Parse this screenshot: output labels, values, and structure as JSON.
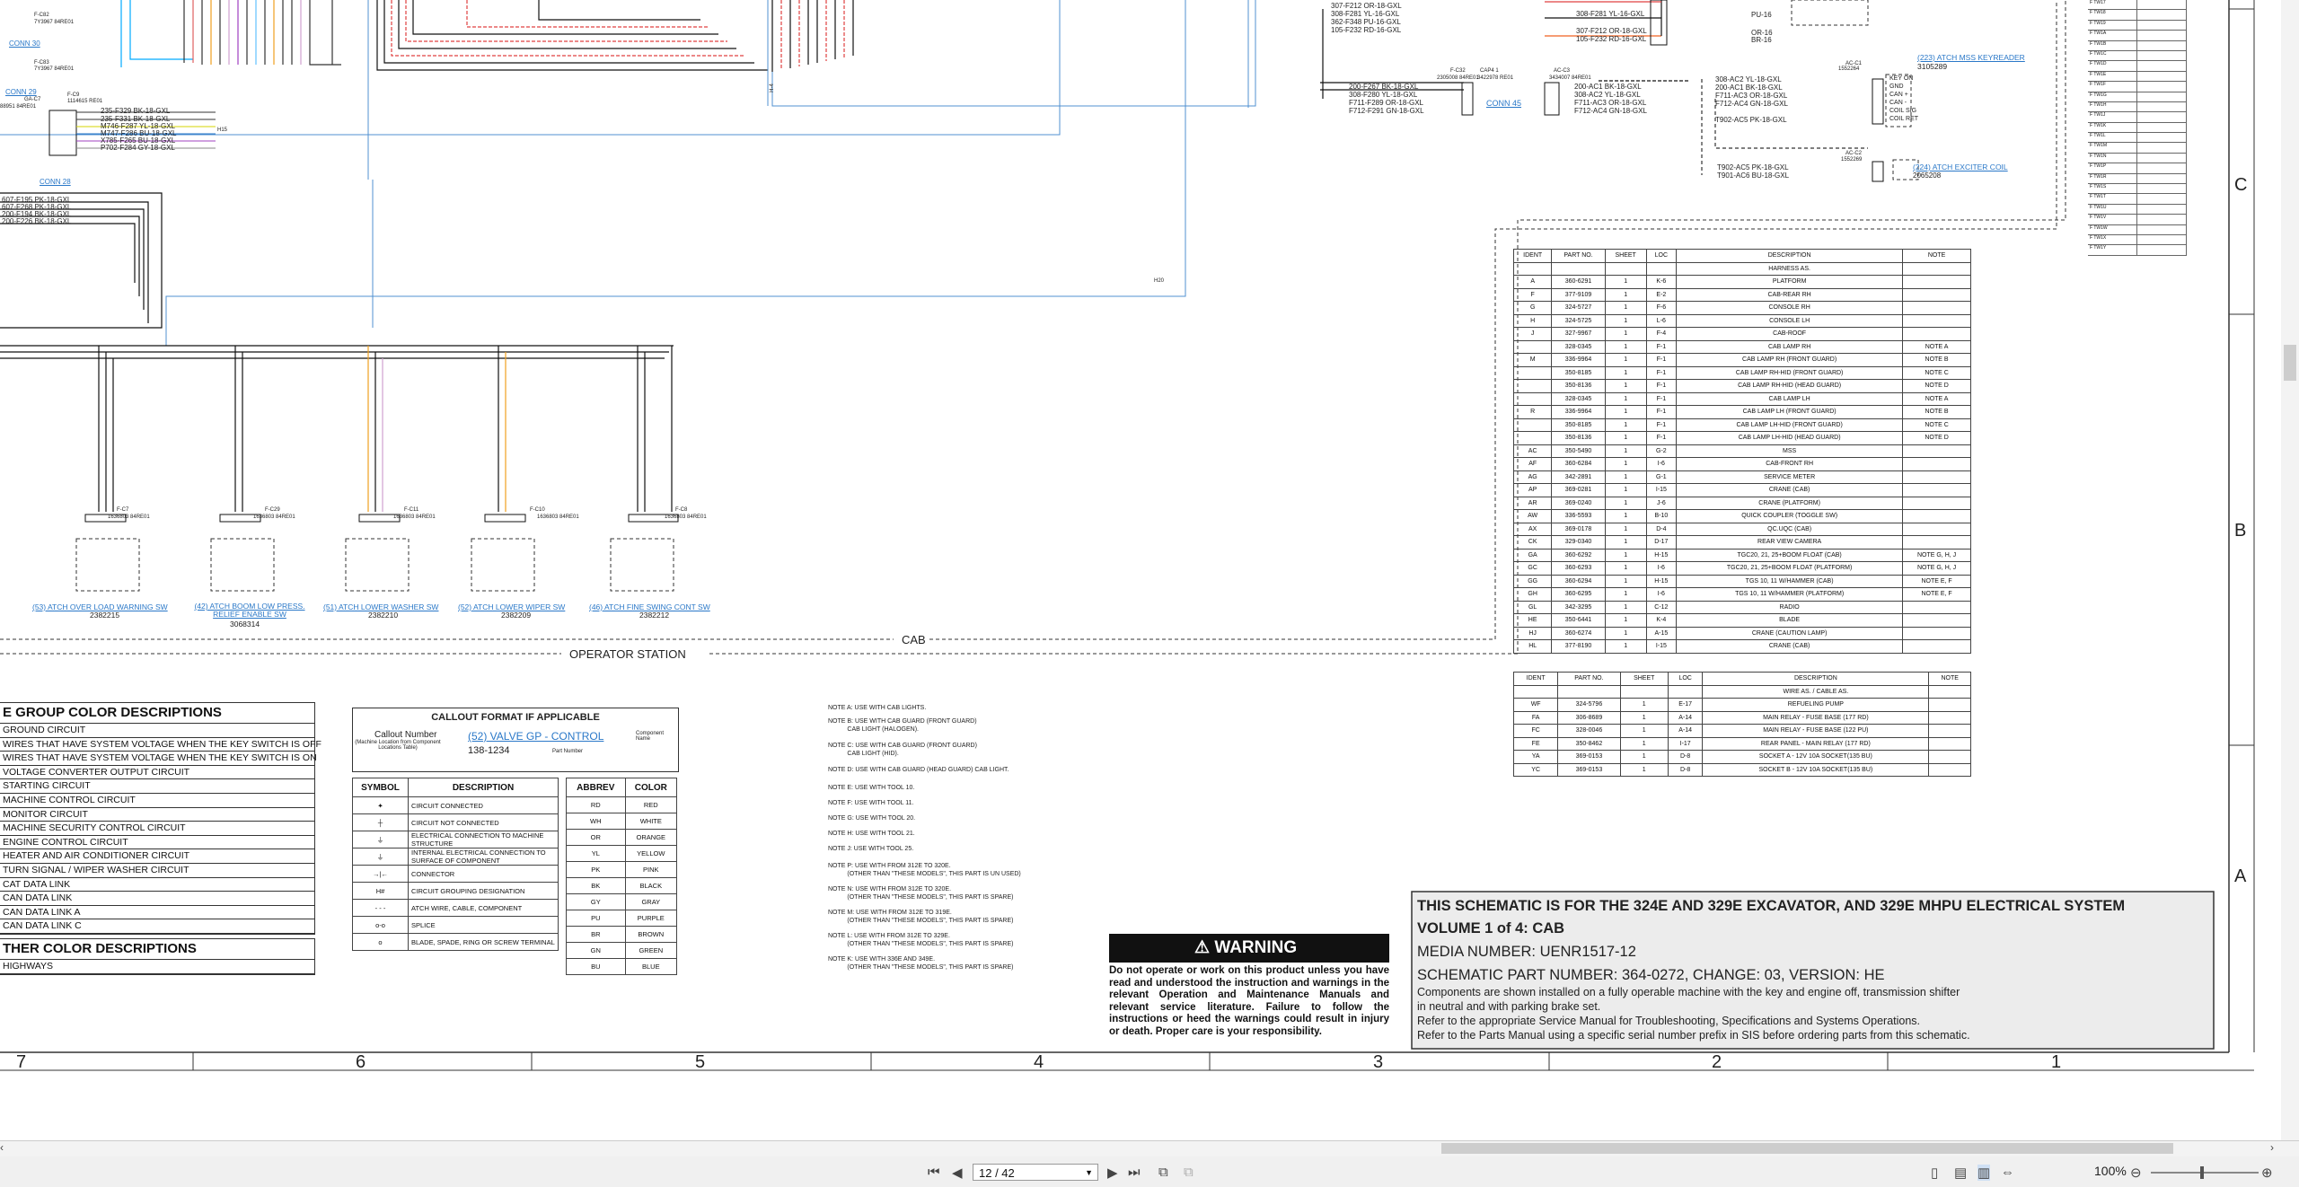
{
  "doc": {
    "cab_label": "CAB",
    "operator_station_label": "OPERATOR STATION",
    "top_right_connectors": {
      "left_wires": [
        "307-F212 OR-18-GXL",
        "308-F281 YL-16-GXL",
        "362-F348 PU-16-GXL",
        "105-F232 RD-16-GXL"
      ],
      "mid_wires": [
        "307-F212 OR-18-GXL",
        "105-F232 RD-16-GXL"
      ],
      "pu_label": "PU-16",
      "or_label": "OR-16",
      "br_label": "BR-16",
      "conn45_wires": [
        "200-F267 BK-18-GXL",
        "308-F280 YL-18-GXL",
        "F711-F289 OR-18-GXL",
        "F712-F291 GN-18-GXL"
      ],
      "c32_label": "F-C32",
      "c32_part": "2305008 84RE01",
      "cap_label": "CAP4 1",
      "cap_part": "3422978 RE01",
      "ac3_label": "AC-C3",
      "ac3_part": "3434007 84RE01",
      "conn45": "CONN 45",
      "ac3_wires": [
        "200-AC1 BK-18-GXL",
        "308-AC2 YL-18-GXL",
        "F711-AC3 OR-18-GXL",
        "F712-AC4 GN-18-GXL"
      ],
      "ac1_wires": [
        "308-AC2 YL-18-GXL",
        "200-AC1 BK-18-GXL",
        "F711-AC3 OR-18-GXL",
        "F712-AC4 GN-18-GXL",
        "T902-AC5 PK-18-GXL"
      ],
      "ac1_label": "AC-C1",
      "ac1_part": "1552264",
      "keyreader_link": "(223) ATCH MSS KEYREADER",
      "keyreader_part": "3105289",
      "ac1_pins": [
        "KEY ON",
        "GND",
        "CAN +",
        "CAN -",
        "COIL SIG",
        "COIL RET"
      ],
      "ac2_label": "AC-C2",
      "ac2_part": "1552269",
      "ac2_wires": [
        "T902-AC5 PK-18-GXL",
        "T901-AC6 BU-18-GXL"
      ],
      "exciter_link": "(224) ATCH EXCITER COIL",
      "exciter_part": "2065208"
    },
    "top_left": {
      "conn30": "CONN 30",
      "conn29": "CONN 29",
      "conn28": "CONN 28",
      "c82": "F-C82",
      "c82_part": "7Y3967 84RE01",
      "c83": "F-C83",
      "c83_part": "7Y3967 84RE01",
      "c7": "GA-C7",
      "c7_part": "88951 84RE01",
      "c9": "F-C9",
      "c9_part": "1114615 RE01",
      "c9_wires": [
        "235-F329 BK-18-GXL",
        "235-F331 BK-18-GXL",
        "M746-F287 YL-18-GXL",
        "M747-F286 BU-18-GXL",
        "X785-F265 BU-18-GXL",
        "P702-F284 GY-18-GXL"
      ],
      "side_wires": [
        "607-F195 PK-18-GXL",
        "607-F268 PK-18-GXL",
        "200-F194 BK-18-GXL",
        "200-F226 BK-18-GXL"
      ],
      "h15": "H15",
      "h4": "H-4",
      "h20": "H20"
    },
    "switches": [
      {
        "conn": "F-C7",
        "part": "1636803 84RE01",
        "link": "(53) ATCH OVER LOAD WARNING SW",
        "num": "2382215"
      },
      {
        "conn": "F-C29",
        "part": "1636803 84RE01",
        "link": "(42) ATCH BOOM LOW PRESS. RELIEF ENABLE SW",
        "num": "3068314"
      },
      {
        "conn": "F-C11",
        "part": "1636803 84RE01",
        "link": "(51) ATCH LOWER WASHER SW",
        "num": "2382210"
      },
      {
        "conn": "F-C10",
        "part": "1636803 84RE01",
        "link": "(52) ATCH LOWER WIPER SW",
        "num": "2382209"
      },
      {
        "conn": "F-C8",
        "part": "1636803 84RE01",
        "link": "(46) ATCH FINE SWING CONT SW",
        "num": "2382212"
      }
    ],
    "group_colors": {
      "title": "E GROUP COLOR DESCRIPTIONS",
      "rows": [
        "GROUND CIRCUIT",
        "WIRES THAT HAVE SYSTEM VOLTAGE WHEN THE KEY SWITCH IS OFF",
        "WIRES THAT HAVE SYSTEM VOLTAGE WHEN THE KEY SWITCH IS ON",
        "VOLTAGE CONVERTER OUTPUT CIRCUIT",
        "STARTING CIRCUIT",
        "MACHINE CONTROL CIRCUIT",
        "MONITOR CIRCUIT",
        "MACHINE SECURITY CONTROL CIRCUIT",
        "ENGINE CONTROL CIRCUIT",
        "HEATER AND AIR CONDITIONER CIRCUIT",
        "TURN SIGNAL / WIPER WASHER CIRCUIT",
        "CAT DATA LINK",
        "CAN DATA LINK",
        "CAN DATA LINK A",
        "CAN DATA LINK C"
      ],
      "other_title": "THER COLOR DESCRIPTIONS",
      "other_rows": [
        "HIGHWAYS"
      ]
    },
    "callout": {
      "title": "CALLOUT FORMAT IF APPLICABLE",
      "callout_number": "Callout Number",
      "callout_sub": "(Machine Location from Component Locations Table)",
      "link": "(52) VALVE GP - CONTROL",
      "component_name": "Component Name",
      "part": "138-1234",
      "part_label": "Part Number"
    },
    "symbols": {
      "h_symbol": "SYMBOL",
      "h_desc": "DESCRIPTION",
      "rows": [
        {
          "sym": "✦",
          "desc": "CIRCUIT CONNECTED"
        },
        {
          "sym": "┼",
          "desc": "CIRCUIT NOT CONNECTED"
        },
        {
          "sym": "⏚",
          "desc": "ELECTRICAL CONNECTION TO MACHINE STRUCTURE"
        },
        {
          "sym": "⏚",
          "desc": "INTERNAL ELECTRICAL CONNECTION TO SURFACE OF COMPONENT"
        },
        {
          "sym": "→|←",
          "desc": "CONNECTOR"
        },
        {
          "sym": "H#",
          "desc": "CIRCUIT GROUPING DESIGNATION"
        },
        {
          "sym": "- - -",
          "desc": "ATCH WIRE, CABLE, COMPONENT"
        },
        {
          "sym": "o-o",
          "desc": "SPLICE"
        },
        {
          "sym": "o",
          "desc": "BLADE, SPADE, RING OR SCREW TERMINAL"
        }
      ]
    },
    "colors": {
      "h_abbrev": "ABBREV",
      "h_color": "COLOR",
      "rows": [
        [
          "RD",
          "RED"
        ],
        [
          "WH",
          "WHITE"
        ],
        [
          "OR",
          "ORANGE"
        ],
        [
          "YL",
          "YELLOW"
        ],
        [
          "PK",
          "PINK"
        ],
        [
          "BK",
          "BLACK"
        ],
        [
          "GY",
          "GRAY"
        ],
        [
          "PU",
          "PURPLE"
        ],
        [
          "BR",
          "BROWN"
        ],
        [
          "GN",
          "GREEN"
        ],
        [
          "BU",
          "BLUE"
        ]
      ]
    },
    "notes": [
      "NOTE A: USE WITH CAB LIGHTS.",
      "NOTE B: USE WITH CAB GUARD (FRONT GUARD)\n           CAB LIGHT (HALOGEN).",
      "NOTE C: USE WITH CAB GUARD (FRONT GUARD)\n           CAB LIGHT (HID).",
      "NOTE D: USE WITH CAB GUARD (HEAD GUARD) CAB LIGHT.",
      "NOTE E: USE WITH TOOL 10.",
      "NOTE F: USE WITH TOOL 11.",
      "NOTE G: USE WITH TOOL 20.",
      "NOTE H: USE WITH TOOL 21.",
      "NOTE J: USE WITH TOOL 25.",
      "NOTE P: USE WITH FROM 312E TO 320E.\n           (OTHER THAN \"THESE MODELS\", THIS PART IS UN USED)",
      "NOTE N: USE WITH FROM 312E TO 320E.\n           (OTHER THAN \"THESE MODELS\", THIS PART IS SPARE)",
      "NOTE M: USE WITH FROM 312E TO 319E.\n           (OTHER THAN \"THESE MODELS\", THIS PART IS SPARE)",
      "NOTE L: USE WITH FROM 312E TO 329E.\n           (OTHER THAN \"THESE MODELS\", THIS PART IS SPARE)",
      "NOTE K: USE WITH 336E AND 349E.\n           (OTHER THAN \"THESE MODELS\", THIS PART IS SPARE)"
    ],
    "warning": {
      "title": "WARNING",
      "text": "Do not operate or work on this product unless you have read and understood the instruction and warnings in the relevant Operation and Maintenance Manuals and relevant service literature. Failure to follow the instructions or heed the warnings could result in injury or death. Proper care is your responsibility."
    },
    "title_block": {
      "line1": "THIS SCHEMATIC IS FOR THE 324E AND 329E EXCAVATOR, AND 329E MHPU ELECTRICAL SYSTEM",
      "line2": "VOLUME 1 of 4: CAB",
      "media": "MEDIA NUMBER: UENR1517-12",
      "schematic": "SCHEMATIC PART NUMBER: 364-0272, CHANGE: 03, VERSION: HE",
      "desc1": "Components are shown installed on a fully operable machine with the key and engine off, transmission shifter",
      "desc2": "in neutral and with parking brake set.",
      "desc3": "Refer to the appropriate Service Manual for Troubleshooting, Specifications and Systems Operations.",
      "desc4": "Refer to the Parts Manual using a specific serial number prefix in SIS before ordering parts from this schematic."
    },
    "harness_table": {
      "headers": [
        "IDENT",
        "PART NO.",
        "SHEET",
        "LOC",
        "DESCRIPTION",
        "NOTE"
      ],
      "section": "HARNESS AS.",
      "rows": [
        [
          "A",
          "360-6291",
          "1",
          "K-6",
          "PLATFORM",
          ""
        ],
        [
          "F",
          "377-9109",
          "1",
          "E-2",
          "CAB-REAR RH",
          ""
        ],
        [
          "G",
          "324-5727",
          "1",
          "F-6",
          "CONSOLE RH",
          ""
        ],
        [
          "H",
          "324-5725",
          "1",
          "L-6",
          "CONSOLE LH",
          ""
        ],
        [
          "J",
          "327-9967",
          "1",
          "F-4",
          "CAB-ROOF",
          ""
        ],
        [
          "",
          "328-0345",
          "1",
          "F-1",
          "CAB LAMP RH",
          "NOTE A"
        ],
        [
          "M",
          "336-9964",
          "1",
          "F-1",
          "CAB LAMP RH (FRONT GUARD)",
          "NOTE B"
        ],
        [
          "",
          "350-8185",
          "1",
          "F-1",
          "CAB LAMP RH-HID (FRONT GUARD)",
          "NOTE C"
        ],
        [
          "",
          "350-8136",
          "1",
          "F-1",
          "CAB LAMP RH-HID (HEAD GUARD)",
          "NOTE D"
        ],
        [
          "",
          "328-0345",
          "1",
          "F-1",
          "CAB LAMP LH",
          "NOTE A"
        ],
        [
          "R",
          "336-9964",
          "1",
          "F-1",
          "CAB LAMP LH (FRONT GUARD)",
          "NOTE B"
        ],
        [
          "",
          "350-8185",
          "1",
          "F-1",
          "CAB LAMP LH-HID (FRONT GUARD)",
          "NOTE C"
        ],
        [
          "",
          "350-8136",
          "1",
          "F-1",
          "CAB LAMP LH-HID (HEAD GUARD)",
          "NOTE D"
        ],
        [
          "AC",
          "350-5490",
          "1",
          "G-2",
          "MSS",
          ""
        ],
        [
          "AF",
          "360-6284",
          "1",
          "I-6",
          "CAB-FRONT RH",
          ""
        ],
        [
          "AG",
          "342-2891",
          "1",
          "G-1",
          "SERVICE METER",
          ""
        ],
        [
          "AP",
          "369-0281",
          "1",
          "I-15",
          "CRANE (CAB)",
          ""
        ],
        [
          "AR",
          "369-0240",
          "1",
          "J-6",
          "CRANE (PLATFORM)",
          ""
        ],
        [
          "AW",
          "336-5593",
          "1",
          "B-10",
          "QUICK COUPLER (TOGGLE SW)",
          ""
        ],
        [
          "AX",
          "369-0178",
          "1",
          "D-4",
          "QC.UQC (CAB)",
          ""
        ],
        [
          "CK",
          "329-0340",
          "1",
          "D-17",
          "REAR VIEW CAMERA",
          ""
        ],
        [
          "GA",
          "360-6292",
          "1",
          "H-15",
          "TGC20, 21, 25+BOOM FLOAT (CAB)",
          "NOTE G, H, J"
        ],
        [
          "GC",
          "360-6293",
          "1",
          "I-6",
          "TGC20, 21, 25+BOOM FLOAT (PLATFORM)",
          "NOTE G, H, J"
        ],
        [
          "GG",
          "360-6294",
          "1",
          "H-15",
          "TGS 10, 11 W/HAMMER (CAB)",
          "NOTE E, F"
        ],
        [
          "GH",
          "360-6295",
          "1",
          "I-6",
          "TGS 10, 11 W/HAMMER (PLATFORM)",
          "NOTE E, F"
        ],
        [
          "GL",
          "342-3295",
          "1",
          "C-12",
          "RADIO",
          ""
        ],
        [
          "HE",
          "350-6441",
          "1",
          "K-4",
          "BLADE",
          ""
        ],
        [
          "HJ",
          "360-6274",
          "1",
          "A-15",
          "CRANE (CAUTION LAMP)",
          ""
        ],
        [
          "HL",
          "377-8190",
          "1",
          "I-15",
          "CRANE (CAB)",
          ""
        ]
      ]
    },
    "wire_table": {
      "headers": [
        "IDENT",
        "PART NO.",
        "SHEET",
        "LOC",
        "DESCRIPTION",
        "NOTE"
      ],
      "section": "WIRE AS. / CABLE AS.",
      "rows": [
        [
          "WF",
          "324-5796",
          "1",
          "E-17",
          "REFUELING PUMP",
          ""
        ],
        [
          "FA",
          "306-8689",
          "1",
          "A-14",
          "MAIN RELAY - FUSE BASE (177 RD)",
          ""
        ],
        [
          "FC",
          "328-0046",
          "1",
          "A-14",
          "MAIN RELAY - FUSE BASE (122 PU)",
          ""
        ],
        [
          "FE",
          "350-8462",
          "1",
          "I-17",
          "REAR PANEL - MAIN RELAY (177 RD)",
          ""
        ],
        [
          "YA",
          "369-0153",
          "1",
          "D-8",
          "SOCKET A - 12V 10A SOCKET(135 BU)",
          ""
        ],
        [
          "YC",
          "369-0153",
          "1",
          "D-8",
          "SOCKET B - 12V 10A SOCKET(135 BU)",
          ""
        ]
      ]
    },
    "right_list": [
      "F TW17",
      "F TW18",
      "F TW19",
      "F TW1A",
      "F TW1B",
      "F TW1C",
      "F TW1D",
      "F TW1E",
      "F TW1F",
      "F TW1G",
      "F TW1H",
      "F TW1J",
      "F TW1K",
      "F TW1L",
      "F TW1M",
      "F TW1N",
      "F TW1P",
      "F TW1R",
      "F TW1S",
      "F TW1T",
      "F TW1U",
      "F TW1V",
      "F TW1W",
      "F TW1X",
      "F TW1Y"
    ],
    "zone_letters": [
      "C",
      "B",
      "A"
    ],
    "zone_numbers": [
      "7",
      "6",
      "5",
      "4",
      "3",
      "2",
      "1"
    ]
  },
  "toolbar": {
    "page_value": "12 / 42",
    "zoom_value": "100%"
  }
}
